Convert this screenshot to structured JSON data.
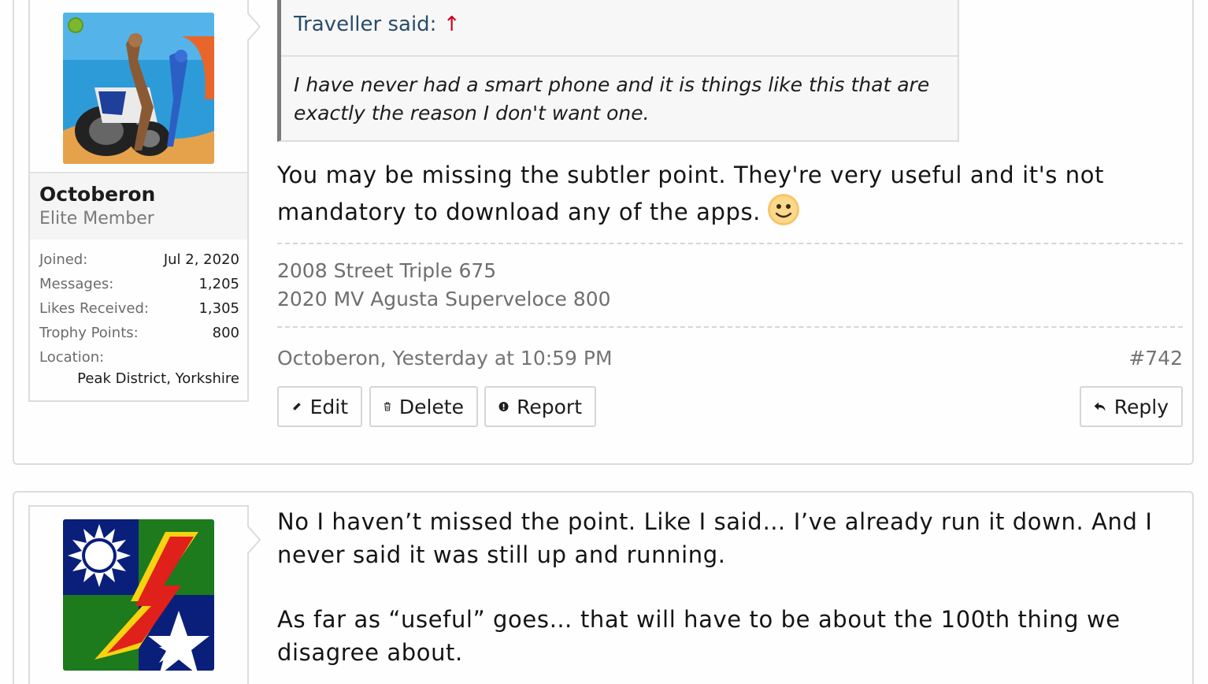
{
  "post1": {
    "user": {
      "name": "Octoberon",
      "title": "Elite Member",
      "stats": [
        {
          "label": "Joined:",
          "value": "Jul 2, 2020"
        },
        {
          "label": "Messages:",
          "value": "1,205"
        },
        {
          "label": "Likes Received:",
          "value": "1,305"
        },
        {
          "label": "Trophy Points:",
          "value": "800"
        }
      ],
      "location_label": "Location:",
      "location_value": "Peak District, Yorkshire"
    },
    "quote": {
      "author": "Traveller said:",
      "arrow": "↑",
      "text": "I have never had a smart phone and it is things like this that are exactly the reason I don't want one."
    },
    "message": "You may be missing the subtler point. They're very useful and it's not mandatory to download any of the apps.",
    "signature": [
      "2008 Street Triple 675",
      "2020 MV Agusta Superveloce 800"
    ],
    "meta": {
      "author_time": "Octoberon, Yesterday at 10:59 PM",
      "post_number": "#742"
    },
    "buttons": {
      "edit": "Edit",
      "delete": "Delete",
      "report": "Report",
      "reply": "Reply"
    }
  },
  "post2": {
    "message_p1": "No I haven’t missed the point. Like I said… I’ve already run it down. And I never said it was still up and running.",
    "message_p2": "As far as “useful” goes… that will have to be about the 100th thing we disagree about."
  }
}
